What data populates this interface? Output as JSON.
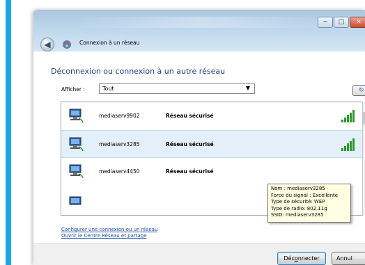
{
  "window": {
    "title": "Connexion à un réseau"
  },
  "content": {
    "heading": "Déconnexion ou connexion à un autre réseau",
    "show_label": "Afficher :",
    "show_value": "Tout"
  },
  "networks": [
    {
      "name": "mediaserv9902",
      "status": "Réseau sécurisé",
      "signal": 5
    },
    {
      "name": "mediaserv3285",
      "status": "Réseau sécurisé",
      "signal": 5
    },
    {
      "name": "mediaserv4450",
      "status": "Réseau sécurisé",
      "signal": 0
    }
  ],
  "tooltip": {
    "line1": "Nom : mediaserv3285",
    "line2": "Force du signal : Excellente",
    "line3": "Type de sécurité: WEP",
    "line4": "Type de radio: 802.11g",
    "line5": "SSID: mediaserv3285"
  },
  "links": {
    "configure": "Configurer une connexion ou un réseau",
    "network_center": "Ouvrir le Centre Réseau et partage"
  },
  "buttons": {
    "disconnect_pre": "Déc",
    "disconnect_key": "o",
    "disconnect_post": "nnecter",
    "cancel": "Annul"
  },
  "colors": {
    "accent_border": "#17a8e0",
    "heading": "#1e3f8a",
    "signal": "#2e9a2a",
    "selection": "#e3eff9",
    "tooltip_bg": "#ffffe1",
    "link": "#1a4fa0"
  }
}
